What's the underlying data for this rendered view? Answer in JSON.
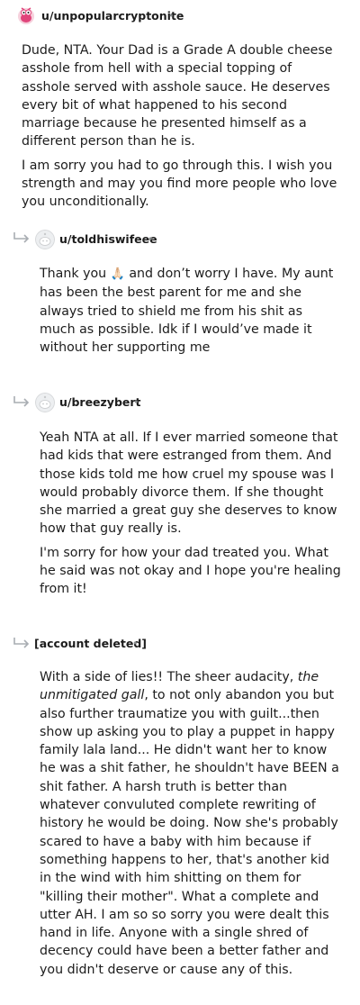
{
  "comments": [
    {
      "username": "u/unpopularcryptonite",
      "dot": "•",
      "paragraphs": [
        "Dude, NTA. Your Dad is a Grade A double cheese asshole from hell with a special topping of asshole served with asshole sauce. He deserves every bit of what happened to his second marriage because he presented himself as a different person than he is.",
        "I am sorry you had to go through this. I wish you strength and may you find more people who love you unconditionally."
      ]
    },
    {
      "username": "u/toldhiswifeee",
      "dot": "•",
      "text_before_emoji": "Thank you",
      "emoji": "🙏🏻",
      "text_after_emoji": "and don’t worry I have. My aunt has been the best parent for me and she always tried to shield me from his shit as much as possible. Idk if I would’ve made it without her supporting me"
    },
    {
      "username": "u/breezybert",
      "dot": "•",
      "paragraphs": [
        "Yeah NTA at all. If I ever married someone that had kids that were estranged from them. And those kids told me how cruel my spouse was I would probably divorce them. If she thought she married a great guy she deserves to know how that guy really is.",
        "I'm sorry for how your dad treated you. What he said was not okay and I hope you're healing from it!"
      ]
    },
    {
      "username": "[account deleted]",
      "dot": "•",
      "part1": "With a side of lies!! The sheer audacity,",
      "italic": "the unmitigated gall",
      "part2": ", to not only abandon you but also further traumatize you with guilt...then show up asking you to play a puppet in happy family lala land... He didn't want her to know he was a shit father, he shouldn't have BEEN a shit father. A harsh truth is better than whatever convuluted complete rewriting of history he would be doing. Now she's probably scared to have a baby with him because if something happens to her, that's another kid in the wind with him shitting on them for \"killing their mother\". What a complete and utter AH. I am so so sorry you were dealt this hand in life. Anyone with a single shred of decency could have been a better father and you didn't deserve or cause any of this."
    }
  ],
  "icons": {
    "reply_arrow": "reply-arrow-icon",
    "default_avatar": "snoo-avatar-icon",
    "user_avatar": "pink-snoo-avatar-icon"
  },
  "colors": {
    "text": "#1c1c1c",
    "meta": "#878a8c",
    "arrow": "#a8adb2",
    "avatar_pink": "#e0457b"
  }
}
